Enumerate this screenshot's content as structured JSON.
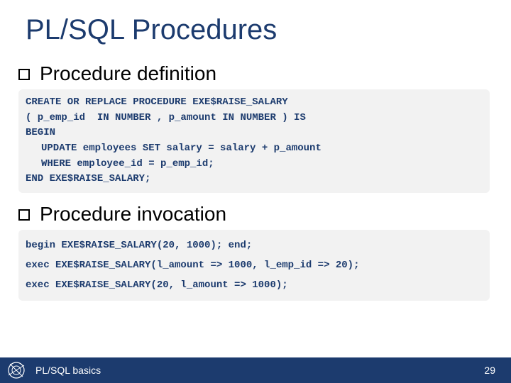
{
  "title": "PL/SQL Procedures",
  "bullets": {
    "def": "Procedure definition",
    "inv": "Procedure invocation"
  },
  "code": {
    "def": {
      "l1": "CREATE OR REPLACE PROCEDURE EXE$RAISE_SALARY",
      "l2": "( p_emp_id  IN NUMBER , p_amount IN NUMBER ) IS",
      "l3": "BEGIN",
      "l4": "UPDATE employees SET salary = salary + p_amount",
      "l5": "WHERE employee_id = p_emp_id;",
      "l6": "END EXE$RAISE_SALARY;"
    },
    "inv": {
      "l1": "begin EXE$RAISE_SALARY(20, 1000); end;",
      "l2": "exec EXE$RAISE_SALARY(l_amount => 1000, l_emp_id => 20);",
      "l3": "exec EXE$RAISE_SALARY(20, l_amount => 1000);"
    }
  },
  "footer": {
    "text": "PL/SQL basics",
    "page": "29"
  }
}
